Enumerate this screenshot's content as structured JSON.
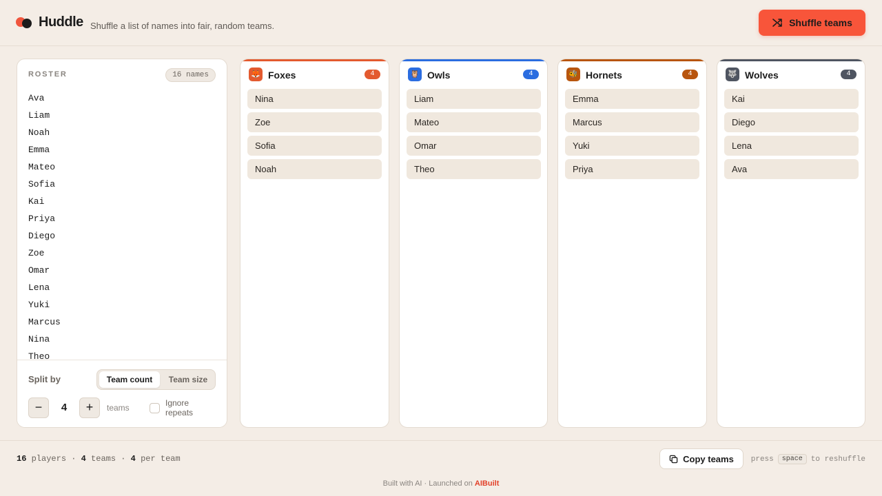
{
  "app": {
    "title": "Huddle",
    "tagline": "Shuffle a list of names into fair, random teams.",
    "shuffle_label": "Shuffle teams"
  },
  "roster": {
    "label": "ROSTER",
    "count_label": "16 names",
    "names": [
      "Ava",
      "Liam",
      "Noah",
      "Emma",
      "Mateo",
      "Sofia",
      "Kai",
      "Priya",
      "Diego",
      "Zoe",
      "Omar",
      "Lena",
      "Yuki",
      "Marcus",
      "Nina",
      "Theo"
    ],
    "split_label": "Split by",
    "split_options": [
      "Team count",
      "Team size"
    ],
    "split_selected": "Team count",
    "stepper_value": "4",
    "stepper_unit": "teams",
    "minus_label": "−",
    "plus_label": "+",
    "ignore_repeats_label": "Ignore repeats",
    "ignore_repeats_checked": false
  },
  "teams": [
    {
      "name": "Foxes",
      "count": "4",
      "color": "#e35a2f",
      "icon": "fox-icon",
      "glyph": "🦊",
      "members": [
        "Nina",
        "Zoe",
        "Sofia",
        "Noah"
      ]
    },
    {
      "name": "Owls",
      "count": "4",
      "color": "#2b6de0",
      "icon": "owl-icon",
      "glyph": "🦉",
      "members": [
        "Liam",
        "Mateo",
        "Omar",
        "Theo"
      ]
    },
    {
      "name": "Hornets",
      "count": "4",
      "color": "#b8550e",
      "icon": "hornet-icon",
      "glyph": "🐝",
      "members": [
        "Emma",
        "Marcus",
        "Yuki",
        "Priya"
      ]
    },
    {
      "name": "Wolves",
      "count": "4",
      "color": "#4f5561",
      "icon": "wolf-icon",
      "glyph": "🐺",
      "members": [
        "Kai",
        "Diego",
        "Lena",
        "Ava"
      ]
    }
  ],
  "footer": {
    "players": "16",
    "players_label": "players",
    "teams": "4",
    "teams_label": "teams",
    "per_team": "4",
    "per_team_label": "per team",
    "copy_label": "Copy teams",
    "hint_prefix": "press",
    "hint_key": "space",
    "hint_suffix": "to reshuffle",
    "credits_prefix": "Built with AI · Launched on",
    "credits_brand": "AIBuilt"
  }
}
